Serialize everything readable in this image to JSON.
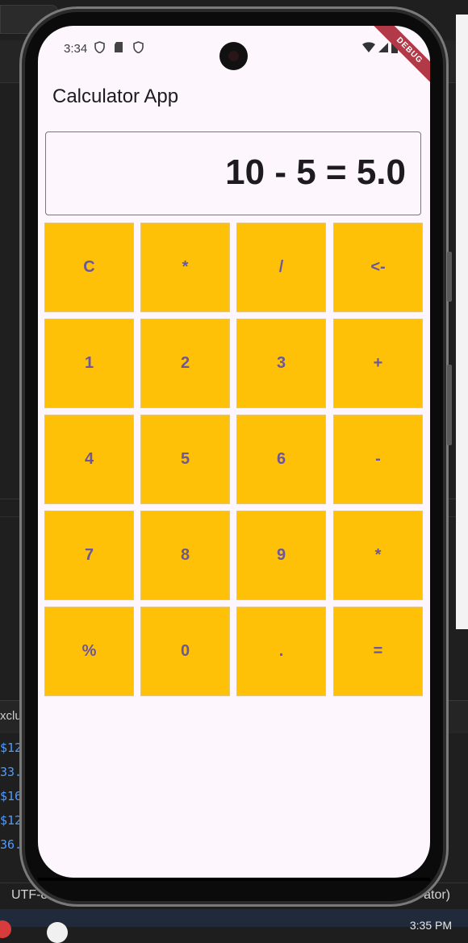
{
  "host": {
    "terminal_tab": "xclu",
    "terminal_lines": [
      "$12",
      "33.",
      "$16",
      "$12",
      "36."
    ],
    "status_left": "UTF-8",
    "status_right": "ator)",
    "clock": "3:35 PM"
  },
  "phone": {
    "status_time": "3:34",
    "debug_banner": "DEBUG",
    "app_title": "Calculator App",
    "display": "10 - 5 = 5.0",
    "keys": [
      [
        "C",
        "*",
        "/",
        "<-"
      ],
      [
        "1",
        "2",
        "3",
        "+"
      ],
      [
        "4",
        "5",
        "6",
        "-"
      ],
      [
        "7",
        "8",
        "9",
        "*"
      ],
      [
        "%",
        "0",
        ".",
        "="
      ]
    ],
    "colors": {
      "key_background": "#ffc107",
      "key_text": "#6b5799",
      "screen_background": "#fdf7fd"
    }
  }
}
